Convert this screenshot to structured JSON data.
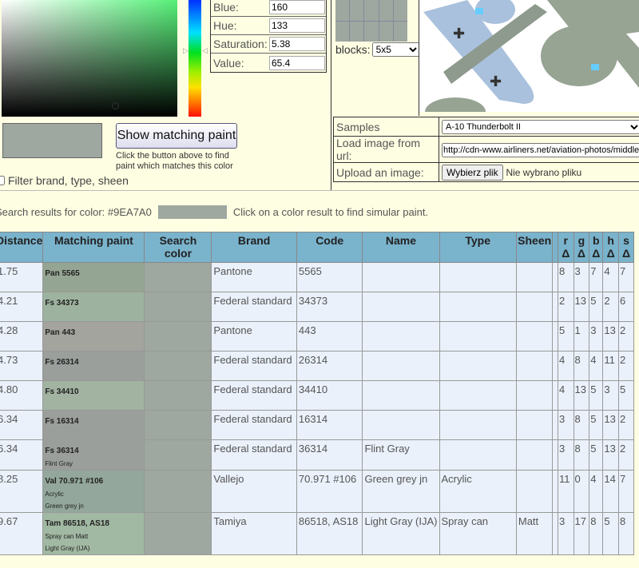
{
  "picker": {
    "fields": [
      {
        "label": "Blue:",
        "value": "160"
      },
      {
        "label": "Hue:",
        "value": "133"
      },
      {
        "label": "Saturation:",
        "value": "5.38"
      },
      {
        "label": "Value:",
        "value": "65.4"
      }
    ],
    "selected_color": "#9EA7A0",
    "show_button": "Show matching paint",
    "hint_line1": "Click the button above to find",
    "hint_line2": "paint which matches this color",
    "filter_label": "Filter brand, type, sheen"
  },
  "sampler": {
    "blocks_label": "blocks:",
    "blocks_value": "5x5"
  },
  "controls": {
    "samples_label": "Samples",
    "samples_value": "A-10 Thunderbolt II",
    "url_label": "Load image from url:",
    "url_value": "http://cdn-www.airliners.net/aviation-photos/middle",
    "upload_label": "Upload an image:",
    "upload_button": "Wybierz plik",
    "upload_status": "Nie wybrano pliku"
  },
  "search": {
    "prefix": "Search results for color: #9EA7A0",
    "hint": "Click on a color result to find simular paint."
  },
  "table": {
    "headers": [
      "Distance",
      "Matching paint",
      "Search color",
      "Brand",
      "Code",
      "Name",
      "Type",
      "Sheen",
      "",
      "r Δ",
      "g Δ",
      "b Δ",
      "h Δ",
      "s Δ"
    ],
    "rows": [
      {
        "dist": "1.75",
        "label": "Pan 5565",
        "sub1": "",
        "sub2": "",
        "color": "#95a593",
        "brand": "Pantone",
        "code": "5565",
        "name": "",
        "type": "",
        "sheen": "",
        "r": "8",
        "g": "3",
        "b": "7",
        "h": "4",
        "s": "7"
      },
      {
        "dist": "4.21",
        "label": "Fs 34373",
        "sub1": "",
        "sub2": "",
        "color": "#9db39f",
        "brand": "Federal standard",
        "code": "34373",
        "name": "",
        "type": "",
        "sheen": "",
        "r": "2",
        "g": "13",
        "b": "5",
        "h": "2",
        "s": "6"
      },
      {
        "dist": "4.28",
        "label": "Pan 443",
        "sub1": "",
        "sub2": "",
        "color": "#a2a49d",
        "brand": "Pantone",
        "code": "443",
        "name": "",
        "type": "",
        "sheen": "",
        "r": "5",
        "g": "1",
        "b": "3",
        "h": "13",
        "s": "2"
      },
      {
        "dist": "4.73",
        "label": "Fs 26314",
        "sub1": "",
        "sub2": "",
        "color": "#9a9f9c",
        "brand": "Federal standard",
        "code": "26314",
        "name": "",
        "type": "",
        "sheen": "",
        "r": "4",
        "g": "8",
        "b": "4",
        "h": "11",
        "s": "2"
      },
      {
        "dist": "4.80",
        "label": "Fs 34410",
        "sub1": "",
        "sub2": "",
        "color": "#a2b3a1",
        "brand": "Federal standard",
        "code": "34410",
        "name": "",
        "type": "",
        "sheen": "",
        "r": "4",
        "g": "13",
        "b": "5",
        "h": "3",
        "s": "5"
      },
      {
        "dist": "6.34",
        "label": "Fs 16314",
        "sub1": "",
        "sub2": "",
        "color": "#9b9f9b",
        "brand": "Federal standard",
        "code": "16314",
        "name": "",
        "type": "",
        "sheen": "",
        "r": "3",
        "g": "8",
        "b": "5",
        "h": "13",
        "s": "2"
      },
      {
        "dist": "6.34",
        "label": "Fs 36314",
        "sub1": "Flint Gray",
        "sub2": "",
        "color": "#9b9f9b",
        "brand": "Federal standard",
        "code": "36314",
        "name": "Flint Gray",
        "type": "",
        "sheen": "",
        "r": "3",
        "g": "8",
        "b": "5",
        "h": "13",
        "s": "2"
      },
      {
        "dist": "8.25",
        "label": "Val 70.971 #106",
        "sub1": "Acrylic",
        "sub2": "Green grey jn",
        "color": "#93a79c",
        "brand": "Vallejo",
        "code": "70.971 #106",
        "name": "Green grey jn",
        "type": "Acrylic",
        "sheen": "",
        "r": "11",
        "g": "0",
        "b": "4",
        "h": "14",
        "s": "7"
      },
      {
        "dist": "9.67",
        "label": "Tam 86518, AS18",
        "sub1": "Spray can    Matt",
        "sub2": "Light Gray (IJA)",
        "color": "#a1b8a2",
        "brand": "Tamiya",
        "code": "86518, AS18",
        "name": "Light Gray (IJA)",
        "type": "Spray can",
        "sheen": "Matt",
        "r": "3",
        "g": "17",
        "b": "8",
        "h": "5",
        "s": "8"
      }
    ]
  }
}
